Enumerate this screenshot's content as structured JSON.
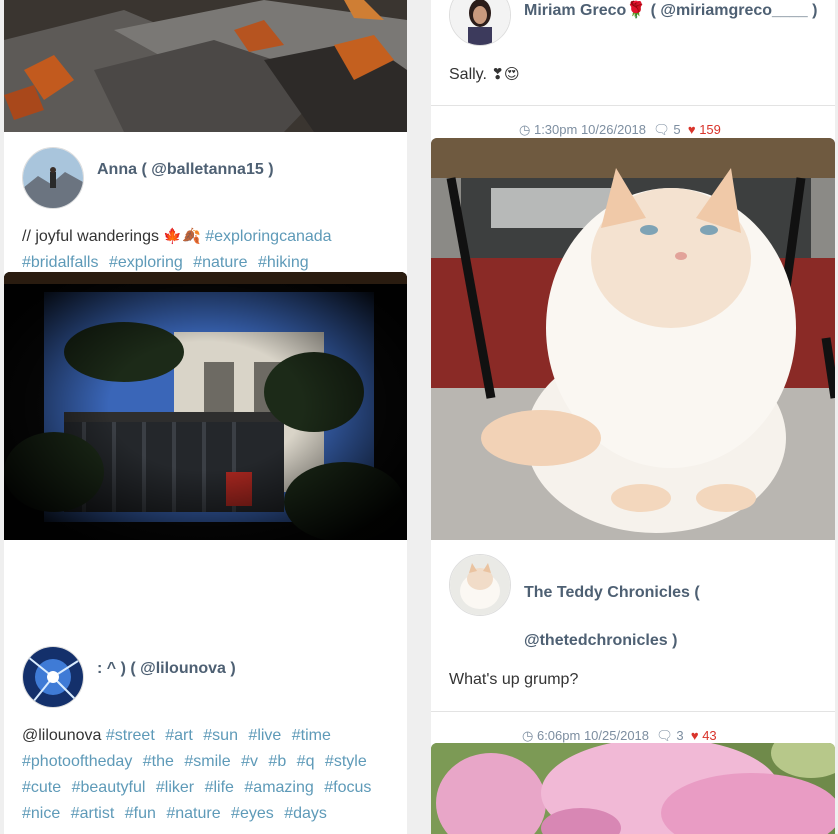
{
  "left": {
    "post_anna": {
      "author_name": "Anna",
      "author_handle": "@balletanna15",
      "caption_text": "// joyful wanderings",
      "caption_emoji": "🍁🍂",
      "tags_line1": [
        "#exploringcanada"
      ],
      "tags_line2": [
        "#bridalfalls",
        "#exploring",
        "#nature",
        "#hiking"
      ]
    },
    "post_lilou": {
      "author_name": ": ^ )",
      "author_handle": "@lilounova",
      "caption_mention": "@lilounova",
      "tags_line1": [
        "#street",
        "#art",
        "#sun",
        "#live",
        "#time"
      ],
      "tags_line2": [
        "#photooftheday",
        "#the",
        "#smile",
        "#v",
        "#b",
        "#q",
        "#style"
      ],
      "tags_line3": [
        "#cute",
        "#beautyful",
        "#liker",
        "#life",
        "#amazing",
        "#focus"
      ],
      "tags_line4": [
        "#nice",
        "#artist",
        "#fun",
        "#nature",
        "#eyes",
        "#days"
      ]
    }
  },
  "right": {
    "post_miriam": {
      "author_name": "Miriam Greco🌹",
      "author_handle": "( @miriamgreco____ )",
      "caption_text": "Sally.",
      "caption_emoji": "❣😍"
    },
    "meta_1": {
      "time": "1:30pm 10/26/2018",
      "comments": "5",
      "likes": "159"
    },
    "post_teddy": {
      "author_name": "The Teddy Chronicles (",
      "author_handle": "@thetedchronicles )",
      "caption_text": "What's up grump?"
    },
    "meta_2": {
      "time": "6:06pm 10/25/2018",
      "comments": "3",
      "likes": "43"
    }
  },
  "icons": {
    "clock": "clock-icon",
    "comments": "comments-icon",
    "heart": "heart-icon"
  },
  "colors": {
    "link": "#5e9ab8",
    "author": "#4e6073",
    "heart": "#d9342b",
    "meta": "#7d8ea0"
  }
}
